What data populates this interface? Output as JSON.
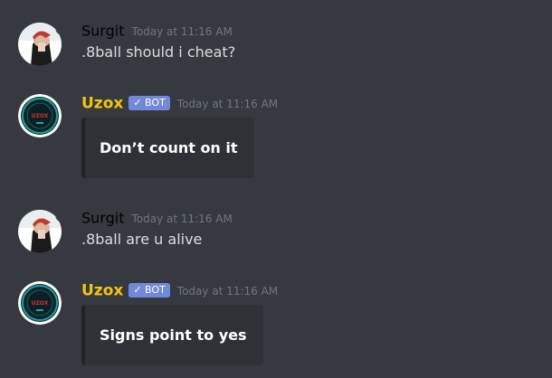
{
  "messages": [
    {
      "author": "Surgit",
      "timestamp": "Today at 11:16 AM",
      "text": ".8ball should i cheat?"
    },
    {
      "author": "Uzox",
      "badge": "✓ BOT",
      "timestamp": "Today at 11:16 AM",
      "embed_text": "Don’t count on it",
      "avatar_text": "UZOX"
    },
    {
      "author": "Surgit",
      "timestamp": "Today at 11:16 AM",
      "text": ".8ball are u alive"
    },
    {
      "author": "Uzox",
      "badge": "✓ BOT",
      "timestamp": "Today at 11:16 AM",
      "embed_text": "Signs point to yes",
      "avatar_text": "UZOX"
    }
  ],
  "colors": {
    "background": "#36393f",
    "bot_username": "#f1c40f",
    "user_username": "#000000",
    "bot_badge": "#7289da",
    "embed_background": "#2f3136",
    "timestamp": "#72767d",
    "message_text": "#dcddde"
  }
}
